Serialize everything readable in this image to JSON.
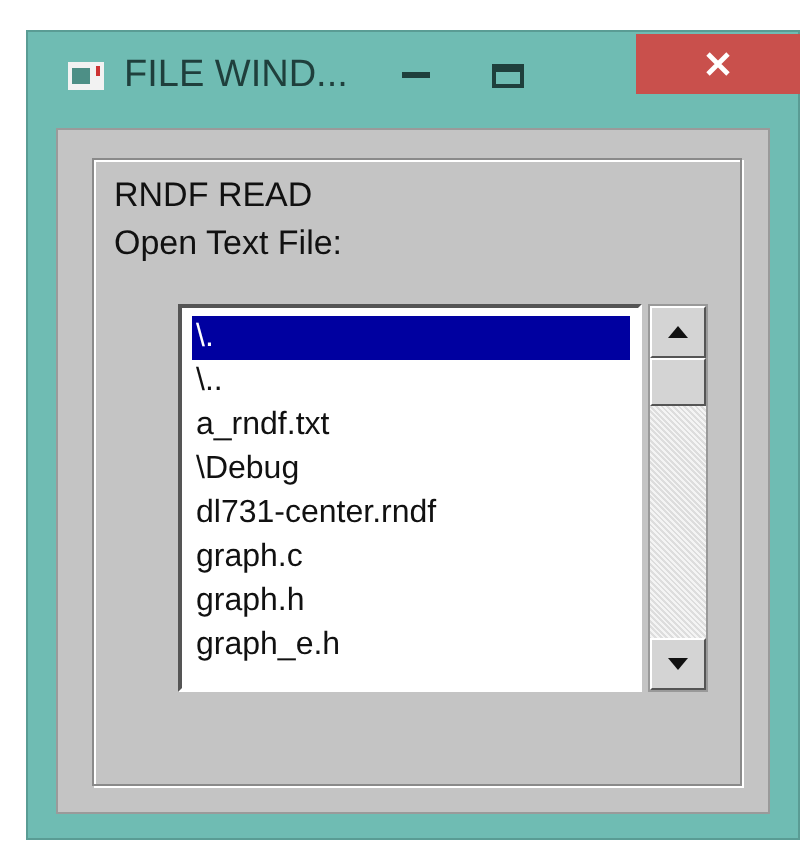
{
  "window": {
    "title": "FILE WIND..."
  },
  "labels": [
    "RNDF READ",
    "Open Text File:"
  ],
  "files": [
    {
      "name": "\\.",
      "selected": true
    },
    {
      "name": "\\..",
      "selected": false
    },
    {
      "name": "a_rndf.txt",
      "selected": false
    },
    {
      "name": "\\Debug",
      "selected": false
    },
    {
      "name": "dl731-center.rndf",
      "selected": false
    },
    {
      "name": "graph.c",
      "selected": false
    },
    {
      "name": "graph.h",
      "selected": false
    },
    {
      "name": "graph_e.h",
      "selected": false
    }
  ]
}
